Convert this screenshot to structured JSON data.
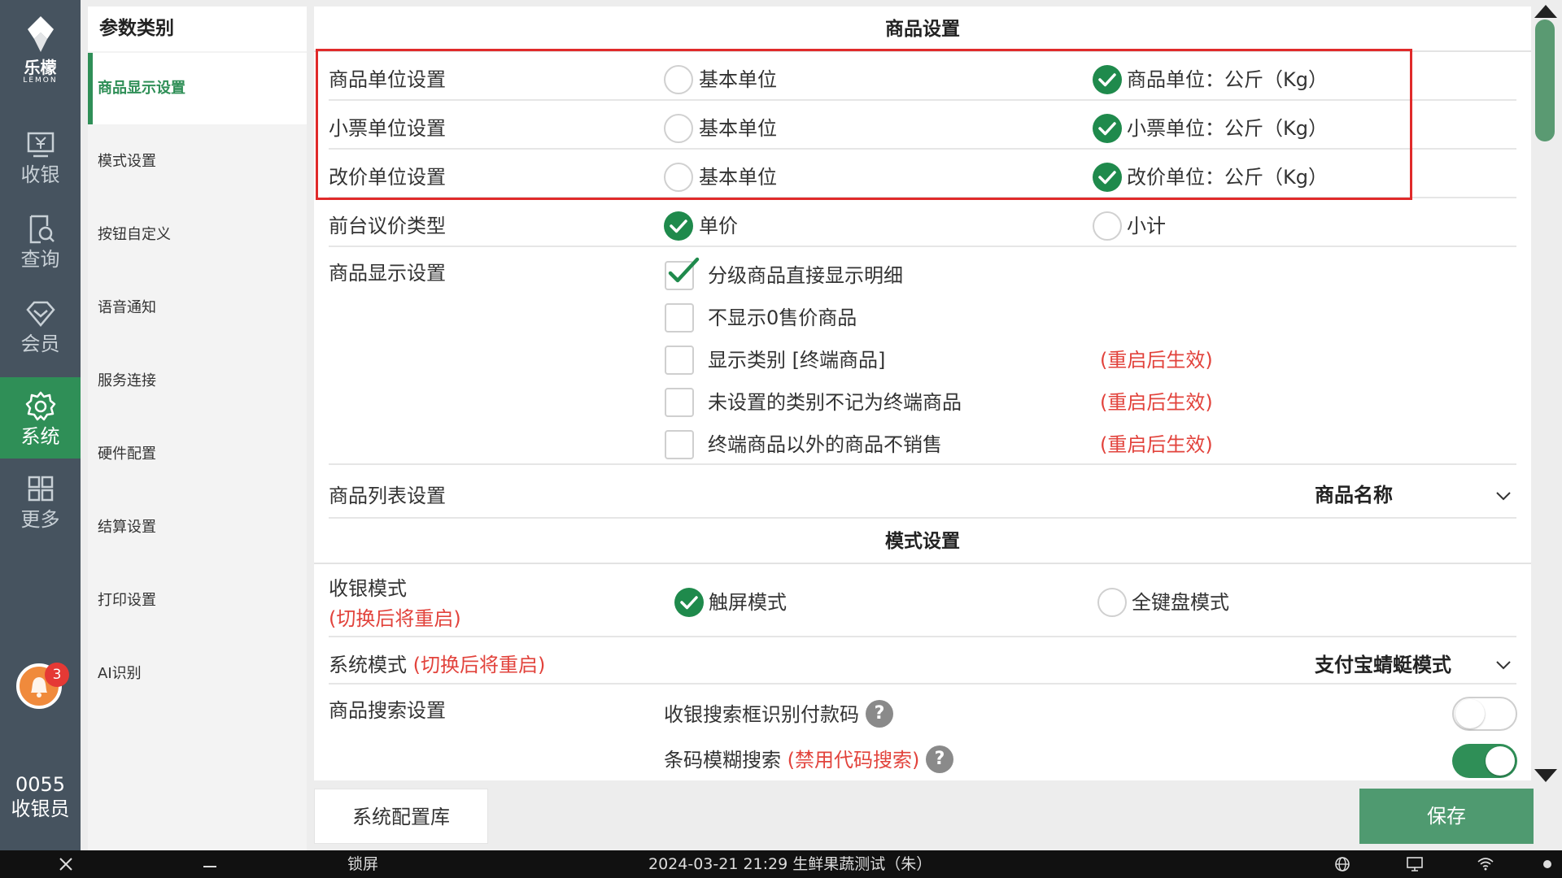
{
  "brand": {
    "name": "乐檬",
    "sub": "LEMON"
  },
  "nav": [
    {
      "label": "收银",
      "icon": "cashier-icon"
    },
    {
      "label": "查询",
      "icon": "query-icon"
    },
    {
      "label": "会员",
      "icon": "member-icon"
    },
    {
      "label": "系统",
      "icon": "gear-icon",
      "active": true
    },
    {
      "label": "更多",
      "icon": "grid-icon"
    }
  ],
  "notifications": {
    "count": "3"
  },
  "user": {
    "id": "0055",
    "role": "收银员"
  },
  "categories": {
    "title": "参数类别",
    "items": [
      "商品显示设置",
      "模式设置",
      "按钮自定义",
      "语音通知",
      "服务连接",
      "硬件配置",
      "结算设置",
      "打印设置",
      "AI识别"
    ],
    "active_index": 0
  },
  "product_settings": {
    "header": "商品设置",
    "unit_rows": [
      {
        "label": "商品单位设置",
        "option_a": "基本单位",
        "option_b": "商品单位：公斤（Kg）",
        "selected": "b"
      },
      {
        "label": "小票单位设置",
        "option_a": "基本单位",
        "option_b": "小票单位：公斤（Kg）",
        "selected": "b"
      },
      {
        "label": "改价单位设置",
        "option_a": "基本单位",
        "option_b": "改价单位：公斤（Kg）",
        "selected": "b"
      }
    ],
    "bargain": {
      "label": "前台议价类型",
      "option_a": "单价",
      "option_b": "小计",
      "selected": "a"
    },
    "display": {
      "label": "商品显示设置",
      "options": [
        {
          "text": "分级商品直接显示明细",
          "checked": true,
          "note": ""
        },
        {
          "text": "不显示0售价商品",
          "checked": false,
          "note": ""
        },
        {
          "text": "显示类别 [终端商品]",
          "checked": false,
          "note": "(重启后生效)"
        },
        {
          "text": "未设置的类别不记为终端商品",
          "checked": false,
          "note": "(重启后生效)"
        },
        {
          "text": "终端商品以外的商品不销售",
          "checked": false,
          "note": "(重启后生效)"
        }
      ]
    },
    "list": {
      "label": "商品列表设置",
      "value": "商品名称"
    }
  },
  "mode_settings": {
    "header": "模式设置",
    "cashier_mode": {
      "label": "收银模式",
      "note": "(切换后将重启)",
      "option_a": "触屏模式",
      "option_b": "全键盘模式",
      "selected": "a"
    },
    "system_mode": {
      "label": "系统模式",
      "note": "(切换后将重启)",
      "value": "支付宝蜻蜓模式"
    },
    "search": {
      "label": "商品搜索设置",
      "items": [
        {
          "text": "收银搜索框识别付款码",
          "note": "",
          "on": false
        },
        {
          "text": "条码模糊搜索",
          "note": "(禁用代码搜索)",
          "on": true
        }
      ]
    }
  },
  "buttons": {
    "config": "系统配置库",
    "save": "保存"
  },
  "taskbar": {
    "lock": "锁屏",
    "status": "2024-03-21 21:29 生鲜果蔬测试（朱）"
  },
  "colors": {
    "rail": "#46535f",
    "accent": "#2f8f57",
    "warning": "#e2433c",
    "highlight": "#e02a2a"
  }
}
